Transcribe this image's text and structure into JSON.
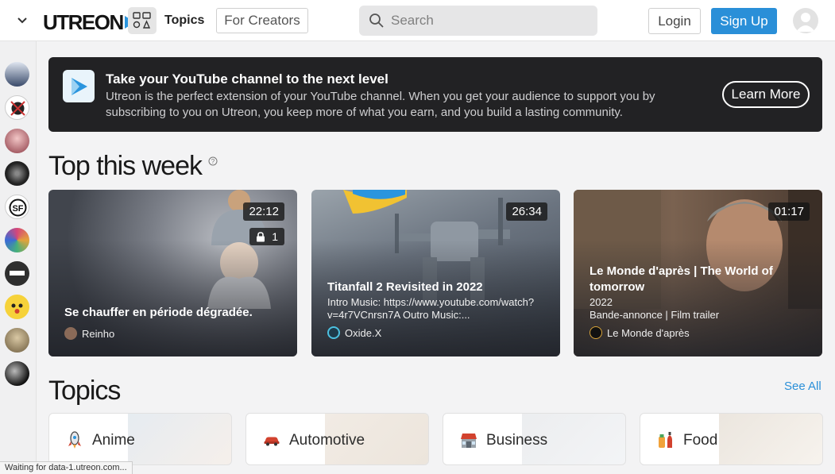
{
  "header": {
    "logo_text": "UTREON",
    "topics_label": "Topics",
    "for_creators_label": "For Creators",
    "search_placeholder": "Search",
    "login_label": "Login",
    "signup_label": "Sign Up"
  },
  "banner": {
    "title": "Take your YouTube channel to the next level",
    "text": "Utreon is the perfect extension of your YouTube channel. When you get your audience to support you by subscribing to you on Utreon, you keep more of what you earn, and you build a lasting community.",
    "learn_more_label": "Learn More"
  },
  "top_week": {
    "title": "Top this week",
    "videos": [
      {
        "duration": "22:12",
        "lock_count": "1",
        "title": "Se chauffer en période dégradée.",
        "channel": "Reinho"
      },
      {
        "duration": "26:34",
        "title": "Titanfall 2 Revisited in 2022",
        "subtitle": "Intro Music: https://www.youtube.com/watch?v=4r7VCnrsn7A Outro Music:...",
        "channel": "Oxide.X"
      },
      {
        "duration": "01:17",
        "title": "Le Monde d'après | The World of tomorrow",
        "subtitle_line1": "2022",
        "subtitle_line2": "Bande-annonce | Film trailer",
        "channel": "Le Monde d'après"
      }
    ]
  },
  "topics": {
    "title": "Topics",
    "see_all_label": "See All",
    "items": [
      {
        "label": "Anime",
        "icon": "rocket-icon"
      },
      {
        "label": "Automotive",
        "icon": "car-icon"
      },
      {
        "label": "Business",
        "icon": "store-icon"
      },
      {
        "label": "Food",
        "icon": "food-icon"
      }
    ]
  },
  "status_text": "Waiting for data-1.utreon.com...",
  "colors": {
    "accent": "#2a8fd8",
    "banner_bg": "#222224",
    "logo_triangle": "#2a95de"
  }
}
